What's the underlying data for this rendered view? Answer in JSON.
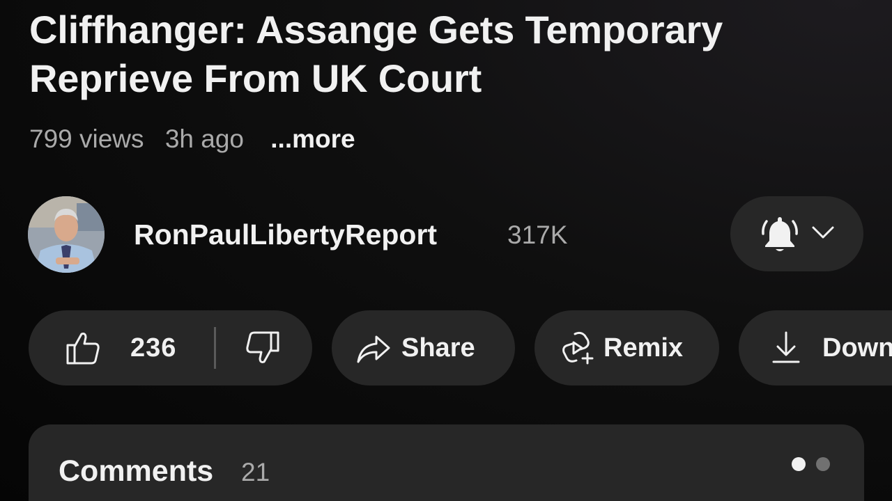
{
  "video": {
    "title": "Cliffhanger: Assange Gets Temporary Reprieve From UK Court",
    "views": "799 views",
    "age": "3h ago",
    "more_label": "...more"
  },
  "channel": {
    "name": "RonPaulLibertyReport",
    "subscribers": "317K",
    "avatar_icon": "channel-avatar",
    "notification_icon": "bell-filled-icon",
    "dropdown_icon": "chevron-down-icon"
  },
  "actions": {
    "like_count": "236",
    "like_icon": "thumbs-up-icon",
    "dislike_icon": "thumbs-down-icon",
    "share_label": "Share",
    "share_icon": "share-arrow-icon",
    "remix_label": "Remix",
    "remix_icon": "remix-icon",
    "download_label": "Down",
    "download_icon": "download-icon"
  },
  "comments": {
    "title": "Comments",
    "count": "21"
  },
  "colors": {
    "background": "#0f0f0f",
    "pill": "#272727",
    "text_primary": "#f1f1f1",
    "text_secondary": "#aaaaaa"
  }
}
